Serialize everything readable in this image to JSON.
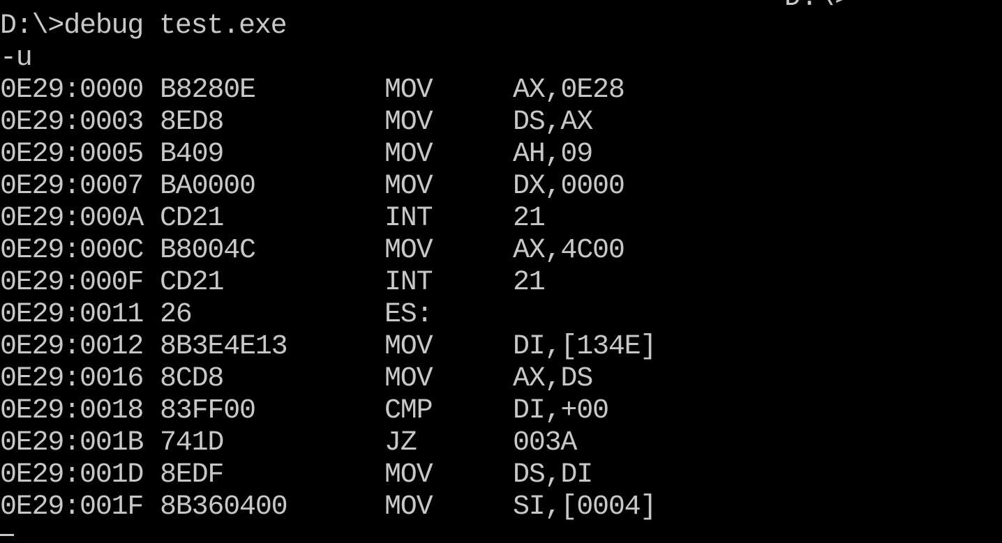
{
  "console": {
    "partial_top": "D:\\>",
    "command": "D:\\>debug test.exe",
    "prompt": "-u",
    "cursor": "-",
    "rows": [
      {
        "addr": "0E29:0000",
        "hex": "B8280E",
        "mnemonic": "MOV",
        "operands": "AX,0E28"
      },
      {
        "addr": "0E29:0003",
        "hex": "8ED8",
        "mnemonic": "MOV",
        "operands": "DS,AX"
      },
      {
        "addr": "0E29:0005",
        "hex": "B409",
        "mnemonic": "MOV",
        "operands": "AH,09"
      },
      {
        "addr": "0E29:0007",
        "hex": "BA0000",
        "mnemonic": "MOV",
        "operands": "DX,0000"
      },
      {
        "addr": "0E29:000A",
        "hex": "CD21",
        "mnemonic": "INT",
        "operands": "21"
      },
      {
        "addr": "0E29:000C",
        "hex": "B8004C",
        "mnemonic": "MOV",
        "operands": "AX,4C00"
      },
      {
        "addr": "0E29:000F",
        "hex": "CD21",
        "mnemonic": "INT",
        "operands": "21"
      },
      {
        "addr": "0E29:0011",
        "hex": "26",
        "mnemonic": "ES:",
        "operands": ""
      },
      {
        "addr": "0E29:0012",
        "hex": "8B3E4E13",
        "mnemonic": "MOV",
        "operands": "DI,[134E]"
      },
      {
        "addr": "0E29:0016",
        "hex": "8CD8",
        "mnemonic": "MOV",
        "operands": "AX,DS"
      },
      {
        "addr": "0E29:0018",
        "hex": "83FF00",
        "mnemonic": "CMP",
        "operands": "DI,+00"
      },
      {
        "addr": "0E29:001B",
        "hex": "741D",
        "mnemonic": "JZ",
        "operands": "003A"
      },
      {
        "addr": "0E29:001D",
        "hex": "8EDF",
        "mnemonic": "MOV",
        "operands": "DS,DI"
      },
      {
        "addr": "0E29:001F",
        "hex": "8B360400",
        "mnemonic": "MOV",
        "operands": "SI,[0004]"
      }
    ]
  },
  "colors": {
    "background": "#000000",
    "text": "#c8c8c8"
  }
}
